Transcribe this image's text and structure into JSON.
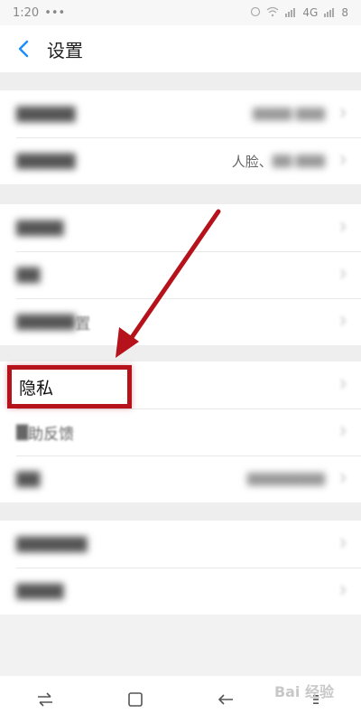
{
  "status_bar": {
    "time": "1:20",
    "dots": "•••",
    "network": "4G",
    "battery": "8"
  },
  "header": {
    "title": "设置"
  },
  "group1": [
    {
      "label": "",
      "value": ""
    },
    {
      "label": "",
      "value": "人脸、"
    }
  ],
  "group2": [
    {
      "label": "",
      "value": ""
    },
    {
      "label": "",
      "value": ""
    },
    {
      "label": "",
      "value": "置"
    }
  ],
  "group3": [
    {
      "label": "隐私",
      "value": ""
    },
    {
      "label": "助反馈",
      "value": ""
    },
    {
      "label": "",
      "value": ""
    }
  ],
  "group4": [
    {
      "label": "",
      "value": ""
    },
    {
      "label": "",
      "value": ""
    }
  ],
  "annotation": {
    "color": "#b5121b"
  },
  "watermark": "Bai 经验"
}
